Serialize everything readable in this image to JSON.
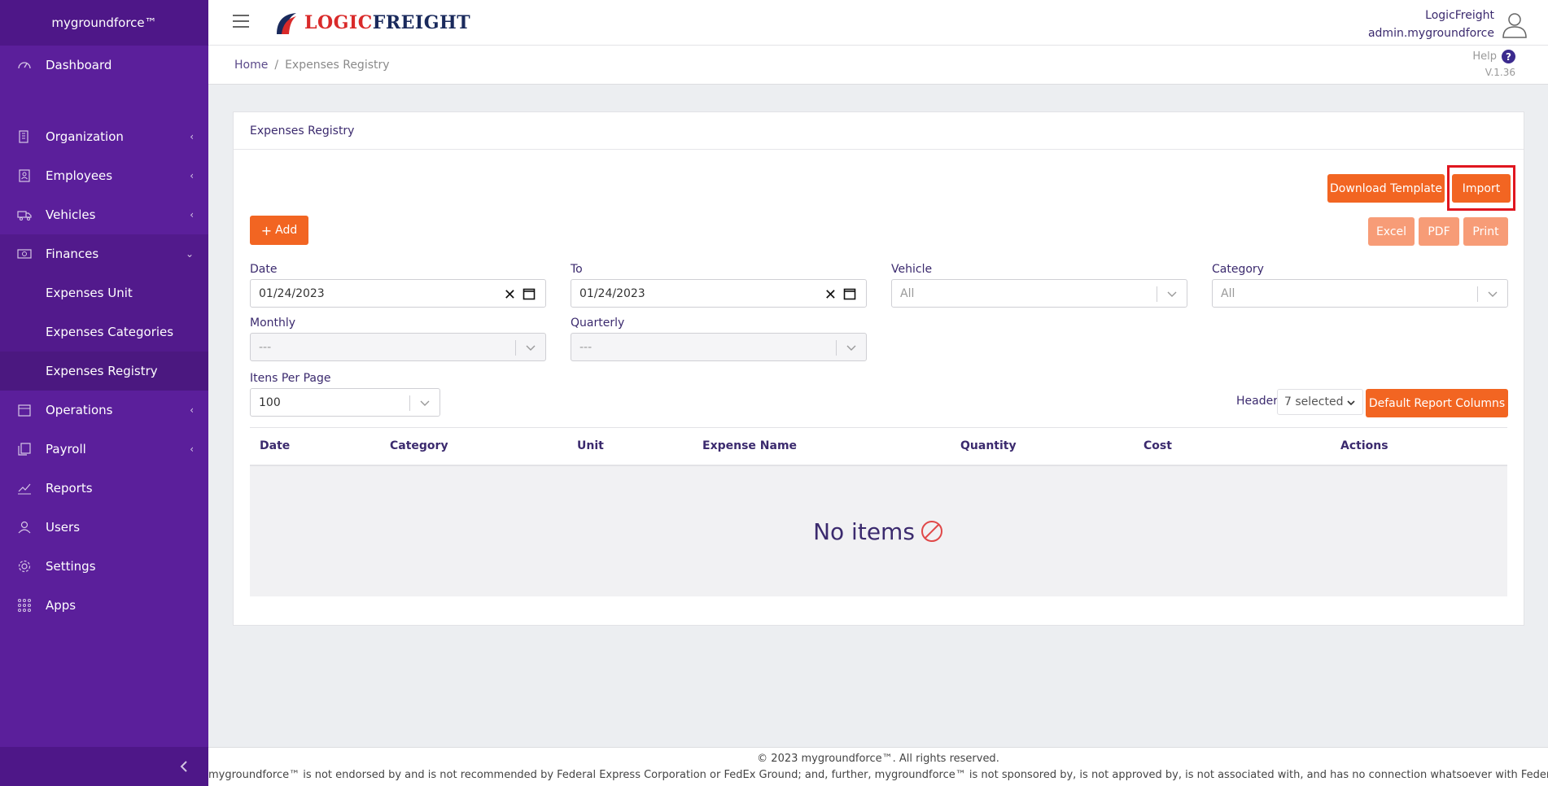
{
  "app": {
    "brand": "mygroundforce™"
  },
  "sidebar": {
    "items": [
      {
        "label": "Dashboard",
        "icon": "speedometer-icon"
      },
      {
        "label": "Organization",
        "icon": "building-icon"
      },
      {
        "label": "Employees",
        "icon": "id-badge-icon"
      },
      {
        "label": "Vehicles",
        "icon": "truck-icon"
      },
      {
        "label": "Finances",
        "icon": "money-icon"
      },
      {
        "label": "Operations",
        "icon": "calendar-icon"
      },
      {
        "label": "Payroll",
        "icon": "copy-icon"
      },
      {
        "label": "Reports",
        "icon": "chart-line-icon"
      },
      {
        "label": "Users",
        "icon": "user-icon"
      },
      {
        "label": "Settings",
        "icon": "gear-icon"
      },
      {
        "label": "Apps",
        "icon": "grid-dots-icon"
      }
    ],
    "finances_sub": [
      {
        "label": "Expenses Unit"
      },
      {
        "label": "Expenses Categories"
      },
      {
        "label": "Expenses Registry"
      }
    ]
  },
  "header": {
    "logo_part1": "LOGIC",
    "logo_part2": "FREIGHT",
    "company": "LogicFreight",
    "username": "admin.mygroundforce"
  },
  "breadcrumb": {
    "home": "Home",
    "current": "Expenses Registry"
  },
  "help": {
    "label": "Help",
    "icon_glyph": "?",
    "version": "V.1.36"
  },
  "card": {
    "title": "Expenses Registry",
    "buttons": {
      "download_template": "Download Template",
      "import": "Import",
      "add": "Add",
      "excel": "Excel",
      "pdf": "PDF",
      "print": "Print",
      "default_columns": "Default Report Columns"
    },
    "filters": {
      "date_label": "Date",
      "date_value": "01/24/2023",
      "to_label": "To",
      "to_value": "01/24/2023",
      "vehicle_label": "Vehicle",
      "vehicle_value": "All",
      "category_label": "Category",
      "category_value": "All",
      "monthly_label": "Monthly",
      "monthly_value": "---",
      "quarterly_label": "Quarterly",
      "quarterly_value": "---",
      "per_page_label": "Itens Per Page",
      "per_page_value": "100"
    },
    "header_select": {
      "label": "Header",
      "value": "7 selected"
    },
    "table": {
      "columns": [
        "Date",
        "Category",
        "Unit",
        "Expense Name",
        "Quantity",
        "Cost",
        "Actions"
      ],
      "empty_text": "No items"
    }
  },
  "footer": {
    "line1": "© 2023 mygroundforce™. All rights reserved.",
    "line2": "mygroundforce™ is not endorsed by and is not recommended by Federal Express Corporation or FedEx Ground; and, further, mygroundforce™ is not sponsored by, is not approved by, is not associated with, and has no connection whatsoever with Federal"
  },
  "colors": {
    "sidebar": "#5b1f9b",
    "accent": "#f26522",
    "text": "#3b2a6e",
    "highlight": "#e0161f"
  }
}
